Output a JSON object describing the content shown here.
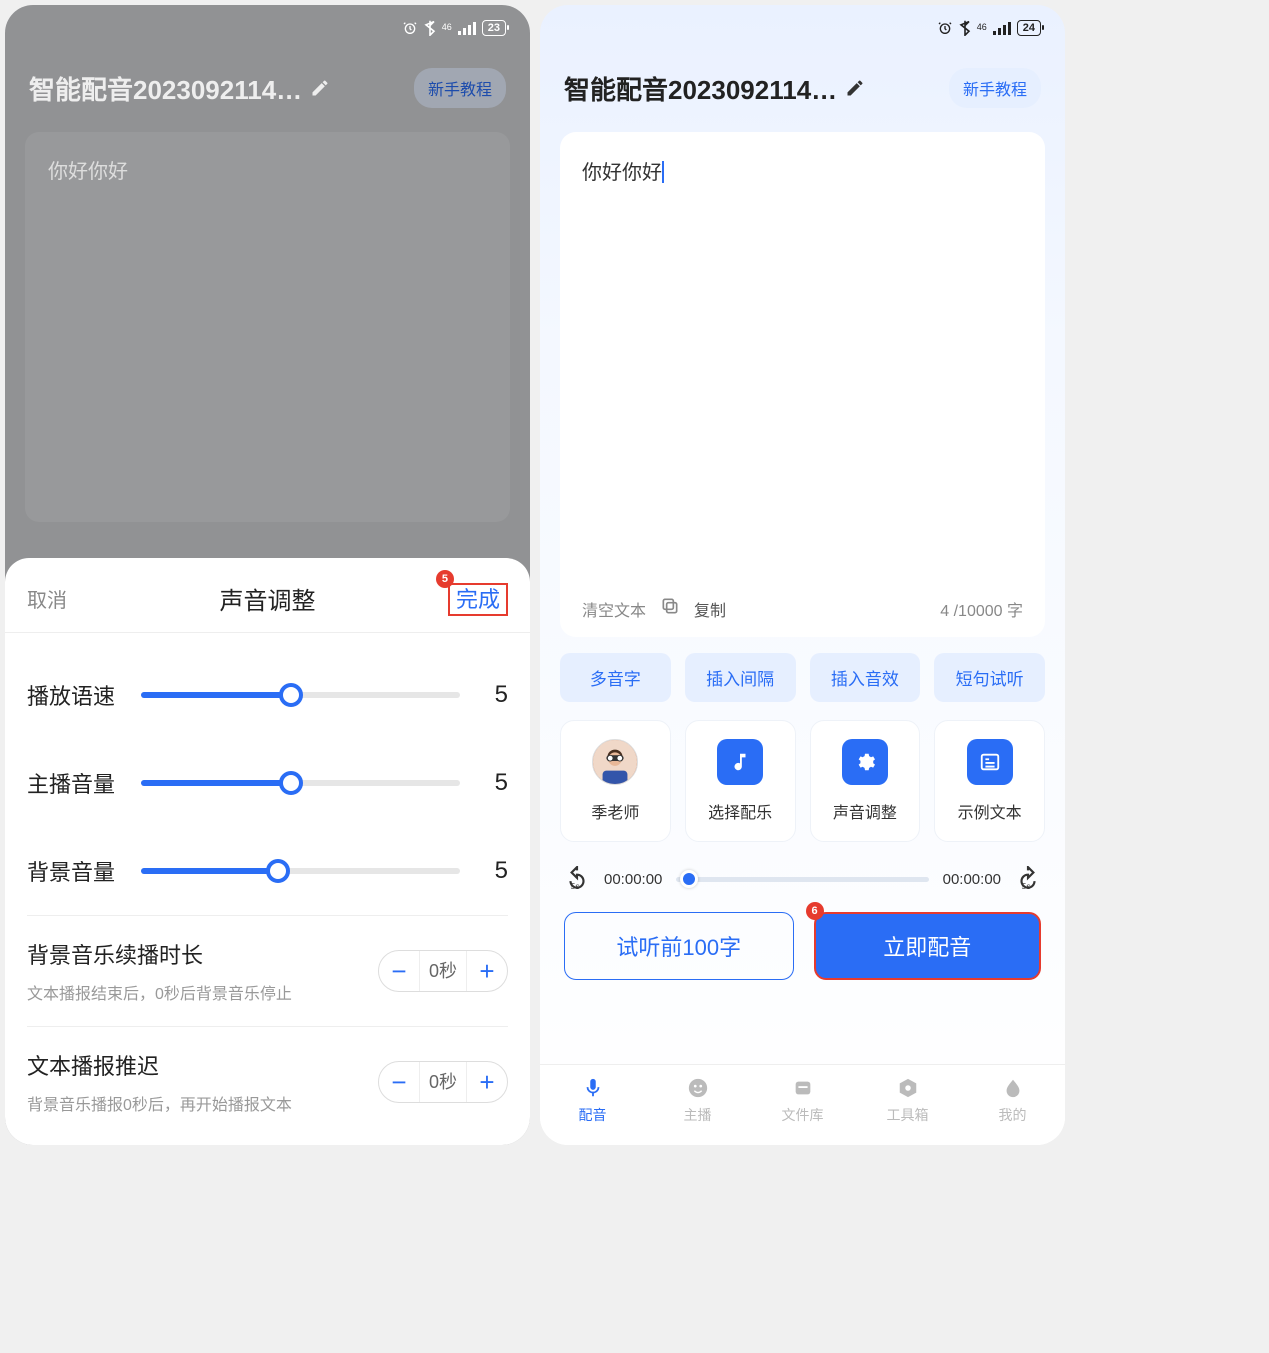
{
  "left": {
    "statusbar": {
      "battery": "23",
      "network": "46"
    },
    "header": {
      "title": "智能配音2023092114…",
      "tutorial": "新手教程"
    },
    "textarea": {
      "content": "你好你好"
    },
    "sheet": {
      "cancel": "取消",
      "title": "声音调整",
      "done": "完成",
      "done_badge": "5",
      "sliders": [
        {
          "label": "播放语速",
          "value": "5",
          "pct": 47
        },
        {
          "label": "主播音量",
          "value": "5",
          "pct": 47
        },
        {
          "label": "背景音量",
          "value": "5",
          "pct": 43
        }
      ],
      "settings": [
        {
          "title": "背景音乐续播时长",
          "subtitle": "文本播报结束后，0秒后背景音乐停止",
          "value": "0秒"
        },
        {
          "title": "文本播报推迟",
          "subtitle": "背景音乐播报0秒后，再开始播报文本",
          "value": "0秒"
        }
      ]
    }
  },
  "right": {
    "statusbar": {
      "battery": "24",
      "network": "46"
    },
    "header": {
      "title": "智能配音2023092114…",
      "tutorial": "新手教程"
    },
    "textarea": {
      "content": "你好你好",
      "clear": "清空文本",
      "copy": "复制",
      "count": "4 /10000 字"
    },
    "chips": [
      "多音字",
      "插入间隔",
      "插入音效",
      "短句试听"
    ],
    "cards": [
      "季老师",
      "选择配乐",
      "声音调整",
      "示例文本"
    ],
    "player": {
      "skip_left": "5s",
      "t1": "00:00:00",
      "t2": "00:00:00",
      "skip_right": "5s"
    },
    "actions": {
      "preview": "试听前100字",
      "go": "立即配音",
      "go_badge": "6"
    },
    "tabs": [
      "配音",
      "主播",
      "文件库",
      "工具箱",
      "我的"
    ]
  }
}
